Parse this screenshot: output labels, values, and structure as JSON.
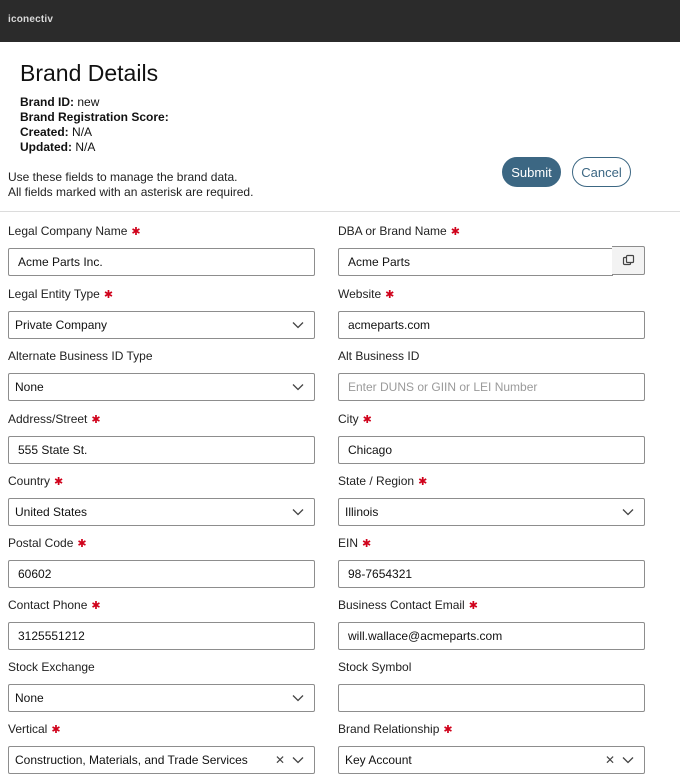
{
  "app": {
    "logo_text": "iconectiv"
  },
  "header": {
    "title": "Brand Details",
    "meta": [
      {
        "label": "Brand ID:",
        "value": "new"
      },
      {
        "label": "Brand Registration Score:",
        "value": ""
      },
      {
        "label": "Created:",
        "value": "N/A"
      },
      {
        "label": "Updated:",
        "value": "N/A"
      }
    ],
    "instructions_line1": "Use these fields to manage the brand data.",
    "instructions_line2": "All fields marked with an asterisk are required."
  },
  "actions": {
    "submit_label": "Submit",
    "cancel_label": "Cancel"
  },
  "required_marker": "✱",
  "fields": {
    "legal_company_name": {
      "label": "Legal Company Name",
      "value": "Acme Parts Inc."
    },
    "dba_brand_name": {
      "label": "DBA or Brand Name",
      "value": "Acme Parts"
    },
    "legal_entity_type": {
      "label": "Legal Entity Type",
      "value": "Private Company"
    },
    "website": {
      "label": "Website",
      "value": "acmeparts.com"
    },
    "alt_business_id_type": {
      "label": "Alternate Business ID Type",
      "value": "None"
    },
    "alt_business_id": {
      "label": "Alt Business ID",
      "value": "",
      "placeholder": "Enter DUNS or GIIN or LEI Number"
    },
    "address_street": {
      "label": "Address/Street",
      "value": "555 State St."
    },
    "city": {
      "label": "City",
      "value": "Chicago"
    },
    "country": {
      "label": "Country",
      "value": "United States"
    },
    "state_region": {
      "label": "State / Region",
      "value": "Illinois"
    },
    "postal_code": {
      "label": "Postal Code",
      "value": "60602"
    },
    "ein": {
      "label": "EIN",
      "value": "98-7654321"
    },
    "contact_phone": {
      "label": "Contact Phone",
      "value": "3125551212"
    },
    "business_contact_email": {
      "label": "Business Contact Email",
      "value": "will.wallace@acmeparts.com"
    },
    "stock_exchange": {
      "label": "Stock Exchange",
      "value": "None"
    },
    "stock_symbol": {
      "label": "Stock Symbol",
      "value": ""
    },
    "vertical": {
      "label": "Vertical",
      "value": "Construction, Materials, and Trade Services"
    },
    "brand_relationship": {
      "label": "Brand Relationship",
      "value": "Key Account"
    }
  },
  "icons": {
    "copy": "copy-icon",
    "chevron": "chevron-down-icon",
    "clear": "clear-icon"
  },
  "colors": {
    "topbar": "#2b2b2b",
    "primary": "#3c6783",
    "required": "#d0021b"
  }
}
